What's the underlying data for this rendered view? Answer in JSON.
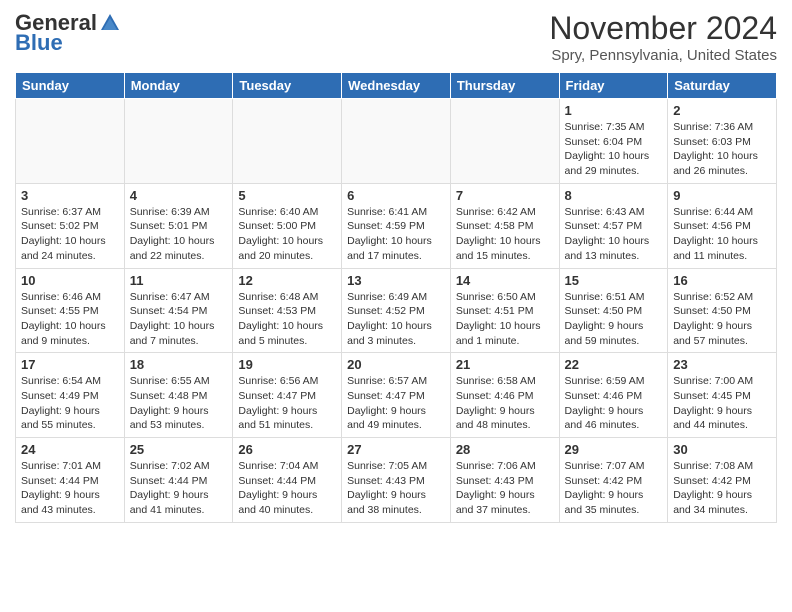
{
  "header": {
    "logo_general": "General",
    "logo_blue": "Blue",
    "month_title": "November 2024",
    "location": "Spry, Pennsylvania, United States"
  },
  "weekdays": [
    "Sunday",
    "Monday",
    "Tuesday",
    "Wednesday",
    "Thursday",
    "Friday",
    "Saturday"
  ],
  "weeks": [
    [
      {
        "day": "",
        "info": ""
      },
      {
        "day": "",
        "info": ""
      },
      {
        "day": "",
        "info": ""
      },
      {
        "day": "",
        "info": ""
      },
      {
        "day": "",
        "info": ""
      },
      {
        "day": "1",
        "info": "Sunrise: 7:35 AM\nSunset: 6:04 PM\nDaylight: 10 hours and 29 minutes."
      },
      {
        "day": "2",
        "info": "Sunrise: 7:36 AM\nSunset: 6:03 PM\nDaylight: 10 hours and 26 minutes."
      }
    ],
    [
      {
        "day": "3",
        "info": "Sunrise: 6:37 AM\nSunset: 5:02 PM\nDaylight: 10 hours and 24 minutes."
      },
      {
        "day": "4",
        "info": "Sunrise: 6:39 AM\nSunset: 5:01 PM\nDaylight: 10 hours and 22 minutes."
      },
      {
        "day": "5",
        "info": "Sunrise: 6:40 AM\nSunset: 5:00 PM\nDaylight: 10 hours and 20 minutes."
      },
      {
        "day": "6",
        "info": "Sunrise: 6:41 AM\nSunset: 4:59 PM\nDaylight: 10 hours and 17 minutes."
      },
      {
        "day": "7",
        "info": "Sunrise: 6:42 AM\nSunset: 4:58 PM\nDaylight: 10 hours and 15 minutes."
      },
      {
        "day": "8",
        "info": "Sunrise: 6:43 AM\nSunset: 4:57 PM\nDaylight: 10 hours and 13 minutes."
      },
      {
        "day": "9",
        "info": "Sunrise: 6:44 AM\nSunset: 4:56 PM\nDaylight: 10 hours and 11 minutes."
      }
    ],
    [
      {
        "day": "10",
        "info": "Sunrise: 6:46 AM\nSunset: 4:55 PM\nDaylight: 10 hours and 9 minutes."
      },
      {
        "day": "11",
        "info": "Sunrise: 6:47 AM\nSunset: 4:54 PM\nDaylight: 10 hours and 7 minutes."
      },
      {
        "day": "12",
        "info": "Sunrise: 6:48 AM\nSunset: 4:53 PM\nDaylight: 10 hours and 5 minutes."
      },
      {
        "day": "13",
        "info": "Sunrise: 6:49 AM\nSunset: 4:52 PM\nDaylight: 10 hours and 3 minutes."
      },
      {
        "day": "14",
        "info": "Sunrise: 6:50 AM\nSunset: 4:51 PM\nDaylight: 10 hours and 1 minute."
      },
      {
        "day": "15",
        "info": "Sunrise: 6:51 AM\nSunset: 4:50 PM\nDaylight: 9 hours and 59 minutes."
      },
      {
        "day": "16",
        "info": "Sunrise: 6:52 AM\nSunset: 4:50 PM\nDaylight: 9 hours and 57 minutes."
      }
    ],
    [
      {
        "day": "17",
        "info": "Sunrise: 6:54 AM\nSunset: 4:49 PM\nDaylight: 9 hours and 55 minutes."
      },
      {
        "day": "18",
        "info": "Sunrise: 6:55 AM\nSunset: 4:48 PM\nDaylight: 9 hours and 53 minutes."
      },
      {
        "day": "19",
        "info": "Sunrise: 6:56 AM\nSunset: 4:47 PM\nDaylight: 9 hours and 51 minutes."
      },
      {
        "day": "20",
        "info": "Sunrise: 6:57 AM\nSunset: 4:47 PM\nDaylight: 9 hours and 49 minutes."
      },
      {
        "day": "21",
        "info": "Sunrise: 6:58 AM\nSunset: 4:46 PM\nDaylight: 9 hours and 48 minutes."
      },
      {
        "day": "22",
        "info": "Sunrise: 6:59 AM\nSunset: 4:46 PM\nDaylight: 9 hours and 46 minutes."
      },
      {
        "day": "23",
        "info": "Sunrise: 7:00 AM\nSunset: 4:45 PM\nDaylight: 9 hours and 44 minutes."
      }
    ],
    [
      {
        "day": "24",
        "info": "Sunrise: 7:01 AM\nSunset: 4:44 PM\nDaylight: 9 hours and 43 minutes."
      },
      {
        "day": "25",
        "info": "Sunrise: 7:02 AM\nSunset: 4:44 PM\nDaylight: 9 hours and 41 minutes."
      },
      {
        "day": "26",
        "info": "Sunrise: 7:04 AM\nSunset: 4:44 PM\nDaylight: 9 hours and 40 minutes."
      },
      {
        "day": "27",
        "info": "Sunrise: 7:05 AM\nSunset: 4:43 PM\nDaylight: 9 hours and 38 minutes."
      },
      {
        "day": "28",
        "info": "Sunrise: 7:06 AM\nSunset: 4:43 PM\nDaylight: 9 hours and 37 minutes."
      },
      {
        "day": "29",
        "info": "Sunrise: 7:07 AM\nSunset: 4:42 PM\nDaylight: 9 hours and 35 minutes."
      },
      {
        "day": "30",
        "info": "Sunrise: 7:08 AM\nSunset: 4:42 PM\nDaylight: 9 hours and 34 minutes."
      }
    ]
  ]
}
